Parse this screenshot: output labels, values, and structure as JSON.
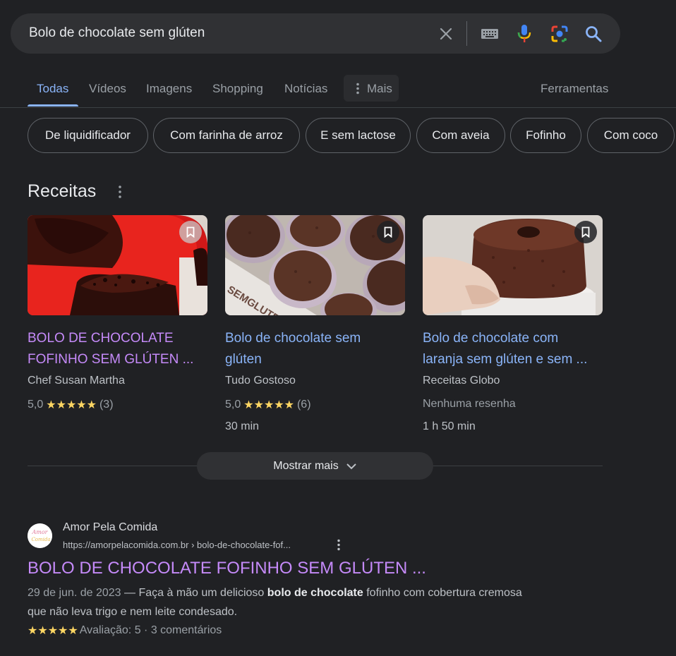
{
  "search": {
    "query": "Bolo de chocolate sem glúten"
  },
  "tabs": [
    {
      "label": "Todas",
      "active": true
    },
    {
      "label": "Vídeos"
    },
    {
      "label": "Imagens"
    },
    {
      "label": "Shopping"
    },
    {
      "label": "Notícias"
    },
    {
      "label": "Mais"
    },
    {
      "label": "Ferramentas"
    }
  ],
  "chips": [
    "De liquidificador",
    "Com farinha de arroz",
    "E sem lactose",
    "Com aveia",
    "Fofinho",
    "Com coco"
  ],
  "recipes": {
    "title": "Receitas",
    "cards": [
      {
        "title_line1": "BOLO DE CHOCOLATE",
        "title_line2": "FOFINHO SEM GLÚTEN ...",
        "source": "Chef Susan Martha",
        "rating": "5,0",
        "reviews": "(3)",
        "stars": "★★★★★",
        "time": ""
      },
      {
        "title_line1": "Bolo de chocolate sem",
        "title_line2": "glúten",
        "source": "Tudo Gostoso",
        "rating": "5,0",
        "reviews": "(6)",
        "stars": "★★★★★",
        "time": "30 min"
      },
      {
        "title_line1": "Bolo de chocolate com",
        "title_line2": "laranja sem glúten e sem ...",
        "source": "Receitas Globo",
        "no_review": "Nenhuma resenha",
        "time": "1 h 50 min"
      }
    ],
    "show_more": "Mostrar mais",
    "image_text": "SEMGLUTEN"
  },
  "result": {
    "site_name": "Amor Pela Comida",
    "url": "https://amorpelacomida.com.br › bolo-de-chocolate-fof...",
    "favicon_text": "Amor Comida",
    "title": "BOLO DE CHOCOLATE FOFINHO SEM GLÚTEN ...",
    "date": "29 de jun. de 2023",
    "snippet_a": " — Faça à mão um delicioso ",
    "snippet_bold": "bolo de chocolate",
    "snippet_b": " fofinho com cobertura cremosa que não leva trigo e nem leite condesado.",
    "stars": "★★★★★",
    "rating_text": "Avaliação: 5 · 3 comentários"
  },
  "colors": {
    "background": "#202124",
    "link": "#8ab4f8",
    "visited": "#c58af9",
    "star": "#fdd663"
  }
}
